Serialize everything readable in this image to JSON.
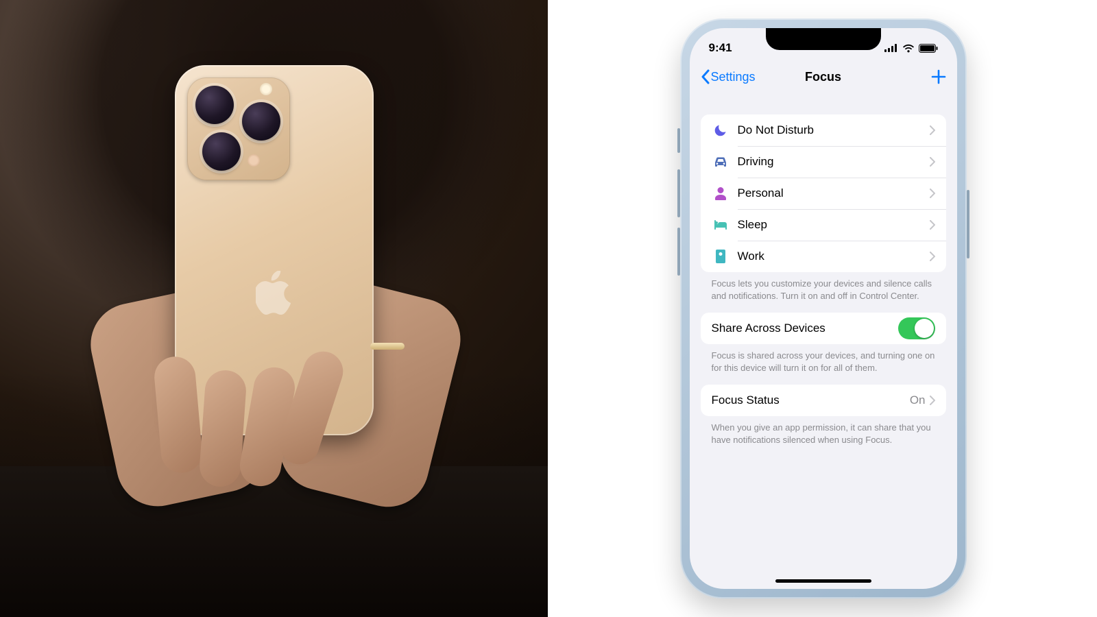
{
  "status": {
    "time": "9:41"
  },
  "nav": {
    "back_label": "Settings",
    "title": "Focus"
  },
  "focus_modes": [
    {
      "icon": "moon-icon",
      "color": "#5e5ce6",
      "label": "Do Not Disturb"
    },
    {
      "icon": "car-icon",
      "color": "#4f6fb8",
      "label": "Driving"
    },
    {
      "icon": "person-icon",
      "color": "#b150c9",
      "label": "Personal"
    },
    {
      "icon": "bed-icon",
      "color": "#46c1b4",
      "label": "Sleep"
    },
    {
      "icon": "badge-icon",
      "color": "#3fb7c1",
      "label": "Work"
    }
  ],
  "focus_footer": "Focus lets you customize your devices and silence calls and notifications. Turn it on and off in Control Center.",
  "share": {
    "label": "Share Across Devices",
    "on": true,
    "footer": "Focus is shared across your devices, and turning one on for this device will turn it on for all of them."
  },
  "status_row": {
    "label": "Focus Status",
    "value": "On",
    "footer": "When you give an app permission, it can share that you have notifications silenced when using Focus."
  },
  "colors": {
    "ios_blue": "#0a7aff",
    "toggle_green": "#34c759"
  }
}
